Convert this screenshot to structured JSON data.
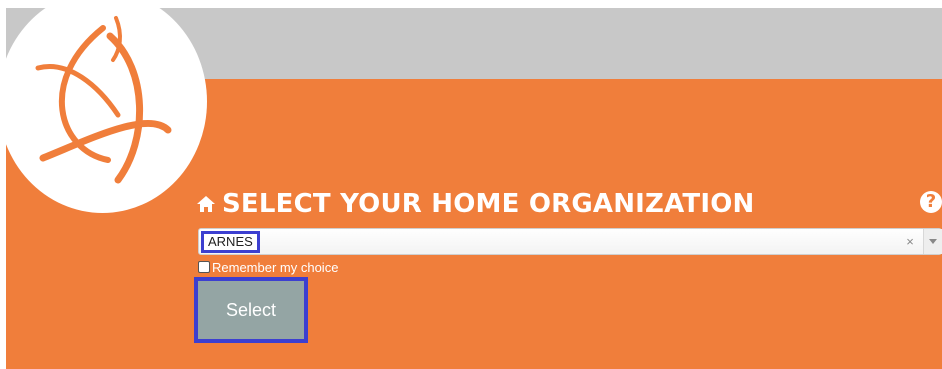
{
  "header": {
    "title": "SELECT YOUR HOME ORGANIZATION",
    "home_icon": "home-icon",
    "help_icon": "help-icon",
    "help_glyph": "?"
  },
  "organization_select": {
    "selected_value": "ARNES",
    "clear_glyph": "×",
    "clear_icon": "clear-icon",
    "dropdown_icon": "chevron-down-icon"
  },
  "remember": {
    "label": "Remember my choice",
    "checked": false
  },
  "submit": {
    "label": "Select"
  },
  "colors": {
    "brand_orange": "#f07e3b",
    "top_band_gray": "#c8c8c8",
    "button_gray": "#94a5a4",
    "focus_outline": "#3c3fd0"
  }
}
